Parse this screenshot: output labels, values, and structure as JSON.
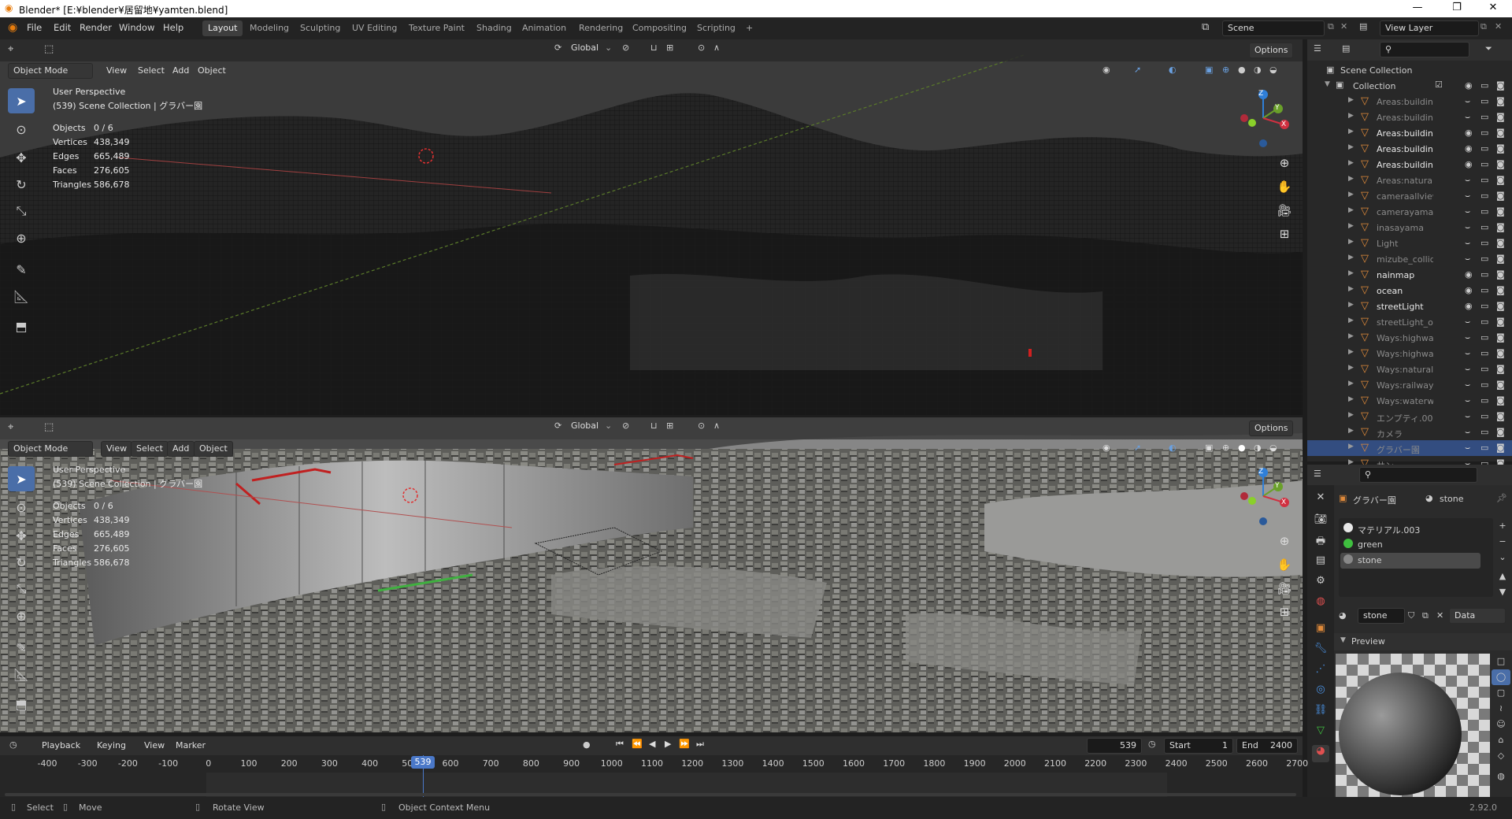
{
  "window": {
    "title": "Blender* [E:¥blender¥居留地¥yamten.blend]",
    "minimize": "—",
    "maximize": "❐",
    "close": "✕"
  },
  "menubar": {
    "menus": [
      "File",
      "Edit",
      "Render",
      "Window",
      "Help"
    ],
    "workspaces": [
      "Layout",
      "Modeling",
      "Sculpting",
      "UV Editing",
      "Texture Paint",
      "Shading",
      "Animation",
      "Rendering",
      "Compositing",
      "Scripting"
    ],
    "active_workspace": "Layout",
    "add_workspace": "+",
    "scene": "Scene",
    "view_layer": "View Layer"
  },
  "viewport_top": {
    "mode": "Object Mode",
    "menus": [
      "View",
      "Select",
      "Add",
      "Object"
    ],
    "orientation": "Global",
    "options": "Options",
    "overlay": {
      "perspective": "User Perspective",
      "collection": "(539) Scene Collection | グラバー園",
      "stats": [
        {
          "k": "Objects",
          "v": "0 / 6"
        },
        {
          "k": "Vertices",
          "v": "438,349"
        },
        {
          "k": "Edges",
          "v": "665,489"
        },
        {
          "k": "Faces",
          "v": "276,605"
        },
        {
          "k": "Triangles",
          "v": "586,678"
        }
      ]
    },
    "shading": "wireframe"
  },
  "viewport_bottom": {
    "mode": "Object Mode",
    "menus": [
      "View",
      "Select",
      "Add",
      "Object"
    ],
    "orientation": "Global",
    "options": "Options",
    "overlay": {
      "perspective": "User Perspective",
      "collection": "(539) Scene Collection | グラバー園",
      "stats": [
        {
          "k": "Objects",
          "v": "0 / 6"
        },
        {
          "k": "Vertices",
          "v": "438,349"
        },
        {
          "k": "Edges",
          "v": "665,489"
        },
        {
          "k": "Faces",
          "v": "276,605"
        },
        {
          "k": "Triangles",
          "v": "586,678"
        }
      ]
    },
    "shading": "solid"
  },
  "gizmo": {
    "z": "Z",
    "y": "Y",
    "x": "X"
  },
  "outliner": {
    "root": "Scene Collection",
    "collection": "Collection",
    "items": [
      {
        "name": "Areas:building",
        "visible": false
      },
      {
        "name": "Areas:building",
        "visible": false
      },
      {
        "name": "Areas:building",
        "visible": true
      },
      {
        "name": "Areas:building",
        "visible": true
      },
      {
        "name": "Areas:building",
        "visible": true
      },
      {
        "name": "Areas:natural",
        "visible": false
      },
      {
        "name": "cameraallview",
        "visible": false
      },
      {
        "name": "camerayamat",
        "visible": false
      },
      {
        "name": "inasayama",
        "visible": false
      },
      {
        "name": "Light",
        "visible": false
      },
      {
        "name": "mizube_collid",
        "visible": false
      },
      {
        "name": "nainmap",
        "visible": true
      },
      {
        "name": "ocean",
        "visible": true
      },
      {
        "name": "streetLight",
        "visible": true
      },
      {
        "name": "streetLight_op",
        "visible": false
      },
      {
        "name": "Ways:highway",
        "visible": false
      },
      {
        "name": "Ways:highway",
        "visible": false
      },
      {
        "name": "Ways:natural",
        "visible": false
      },
      {
        "name": "Ways:railway",
        "visible": false
      },
      {
        "name": "Ways:waterw",
        "visible": false
      },
      {
        "name": "エンプティ.00",
        "visible": false
      },
      {
        "name": "カメラ",
        "visible": false
      },
      {
        "name": "グラバー園",
        "visible": false,
        "selected": true
      },
      {
        "name": "サン",
        "visible": false
      }
    ]
  },
  "properties": {
    "object": "グラバー園",
    "material": "stone",
    "slots": [
      "マテリアル.003",
      "green",
      "stone"
    ],
    "active_slot": "stone",
    "slot_colors": [
      "#e8e8e8",
      "#3fbf3f",
      "#888888"
    ],
    "material_name": "stone",
    "link": "Data",
    "preview_label": "Preview"
  },
  "timeline": {
    "menus": [
      "Playback",
      "Keying",
      "View",
      "Marker"
    ],
    "current_frame": "539",
    "start_label": "Start",
    "start": "1",
    "end_label": "End",
    "end": "2400",
    "ticks": [
      "-400",
      "-300",
      "-200",
      "-100",
      "0",
      "100",
      "200",
      "300",
      "400",
      "500",
      "600",
      "700",
      "800",
      "900",
      "1000",
      "1100",
      "1200",
      "1300",
      "1400",
      "1500",
      "1600",
      "1700",
      "1800",
      "1900",
      "2000",
      "2100",
      "2200",
      "2300",
      "2400",
      "2500",
      "2600",
      "2700"
    ],
    "playhead_label": "539"
  },
  "statusbar": {
    "select": "Select",
    "move": "Move",
    "rotate": "Rotate View",
    "context": "Object Context Menu",
    "version": "2.92.0"
  }
}
